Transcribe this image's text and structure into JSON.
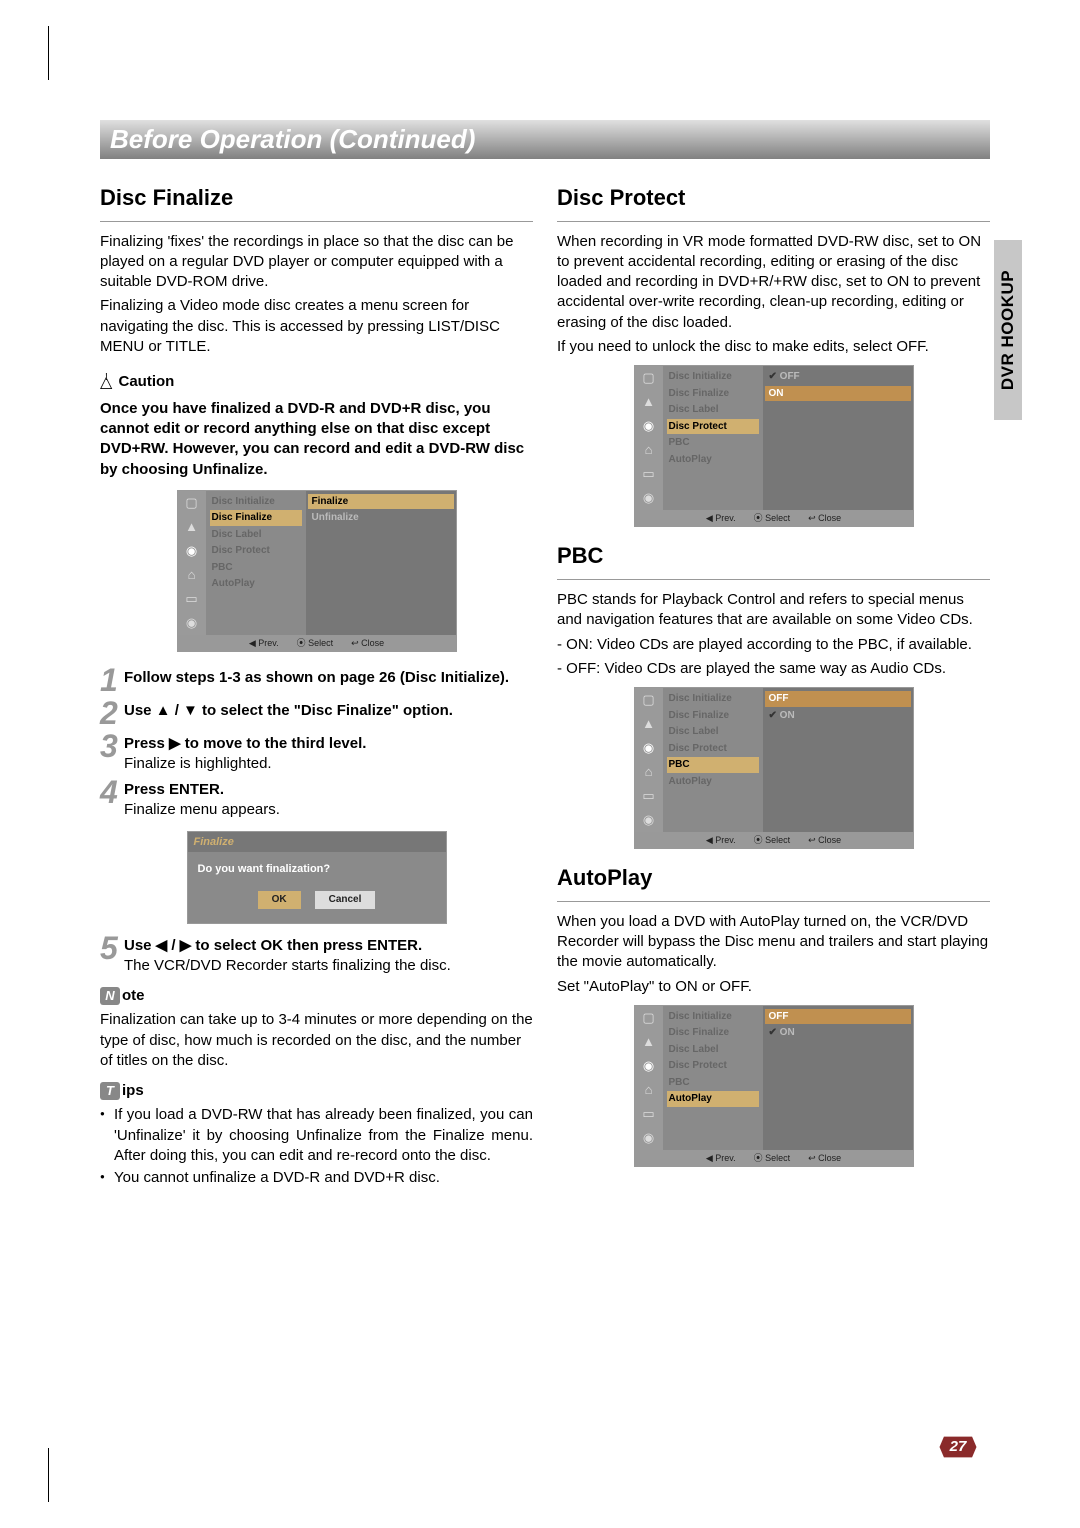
{
  "header": {
    "title": "Before Operation (Continued)"
  },
  "side_tab": "DVR HOOKUP",
  "page_number": "27",
  "left": {
    "disc_finalize": {
      "title": "Disc Finalize",
      "p1": "Finalizing 'fixes' the recordings in place so that the disc can be played on a regular DVD player or computer equipped with a suitable DVD-ROM drive.",
      "p2": "Finalizing a Video mode disc creates a menu screen for navigating the disc. This is accessed by pressing LIST/DISC MENU or TITLE.",
      "caution_label": "Caution",
      "caution_text": "Once you have finalized a DVD-R and DVD+R disc, you cannot edit or record anything else on that disc except DVD+RW. However, you can record and edit a DVD-RW disc by choosing Unfinalize.",
      "menu": {
        "items": [
          "Disc Initialize",
          "Disc Finalize",
          "Disc Label",
          "Disc Protect",
          "PBC",
          "AutoPlay"
        ],
        "selected_index": 1,
        "options": [
          "Finalize",
          "Unfinalize"
        ],
        "footer": {
          "prev": "◀ Prev.",
          "select": "⦿ Select",
          "close": "↩ Close"
        }
      },
      "steps": {
        "s1": "Follow steps 1-3 as shown on page 26 (Disc Initialize).",
        "s2": "Use ▲ / ▼ to select the \"Disc Finalize\" option.",
        "s3a": "Press ▶ to move to the third level.",
        "s3b": "Finalize is highlighted.",
        "s4a": "Press ENTER.",
        "s4b": "Finalize menu appears.",
        "s5a": "Use ◀ / ▶ to select OK then press ENTER.",
        "s5b": "The VCR/DVD Recorder starts finalizing the disc."
      },
      "dialog": {
        "title": "Finalize",
        "question": "Do you want finalization?",
        "ok": "OK",
        "cancel": "Cancel"
      },
      "note_label_suffix": "ote",
      "note_icon": "N",
      "note_text": "Finalization can take up to 3-4 minutes or more depending on the type of disc, how much is recorded on the disc, and the number of titles on the disc.",
      "tips_label_suffix": "ips",
      "tips_icon": "T",
      "tip1": "If you load a DVD-RW that has already been finalized, you can 'Unfinalize' it by choosing Unfinalize from the Finalize menu. After doing this, you can edit and re-record onto the disc.",
      "tip2": "You cannot unfinalize a DVD-R and DVD+R disc."
    }
  },
  "right": {
    "disc_protect": {
      "title": "Disc Protect",
      "p1": "When recording in VR mode formatted DVD-RW disc, set to ON to prevent accidental recording, editing or erasing of the disc loaded and recording in DVD+R/+RW disc, set to ON to prevent accidental over-write recording, clean-up recording, editing or erasing of the disc loaded.",
      "p2": "If you need to unlock the disc to make edits, select OFF.",
      "menu": {
        "items": [
          "Disc Initialize",
          "Disc Finalize",
          "Disc Label",
          "Disc Protect",
          "PBC",
          "AutoPlay"
        ],
        "selected_index": 3,
        "options": [
          {
            "label": "OFF",
            "check": true
          },
          {
            "label": "ON",
            "check": false,
            "high": true
          }
        ],
        "footer": {
          "prev": "◀ Prev.",
          "select": "⦿ Select",
          "close": "↩ Close"
        }
      }
    },
    "pbc": {
      "title": "PBC",
      "p1": "PBC stands for Playback Control and refers to special menus and navigation features that are available on some Video CDs.",
      "li1": "- ON: Video CDs are played according to the PBC, if available.",
      "li2": "- OFF: Video CDs are played the same way as Audio CDs.",
      "menu": {
        "items": [
          "Disc Initialize",
          "Disc Finalize",
          "Disc Label",
          "Disc Protect",
          "PBC",
          "AutoPlay"
        ],
        "selected_index": 4,
        "options": [
          {
            "label": "OFF",
            "high": true
          },
          {
            "label": "ON",
            "check": true
          }
        ],
        "footer": {
          "prev": "◀ Prev.",
          "select": "⦿ Select",
          "close": "↩ Close"
        }
      }
    },
    "autoplay": {
      "title": "AutoPlay",
      "p1": "When you load a DVD with AutoPlay turned on, the VCR/DVD Recorder will bypass the Disc menu and trailers and start playing the movie automatically.",
      "p2": "Set \"AutoPlay\" to ON or OFF.",
      "menu": {
        "items": [
          "Disc Initialize",
          "Disc Finalize",
          "Disc Label",
          "Disc Protect",
          "PBC",
          "AutoPlay"
        ],
        "selected_index": 5,
        "options": [
          {
            "label": "OFF",
            "high": true
          },
          {
            "label": "ON",
            "check": true
          }
        ],
        "footer": {
          "prev": "◀ Prev.",
          "select": "⦿ Select",
          "close": "↩ Close"
        }
      }
    }
  },
  "icons_glyphs": [
    "▢",
    "▲",
    "⬤",
    "⌂",
    "▭",
    "◉"
  ]
}
